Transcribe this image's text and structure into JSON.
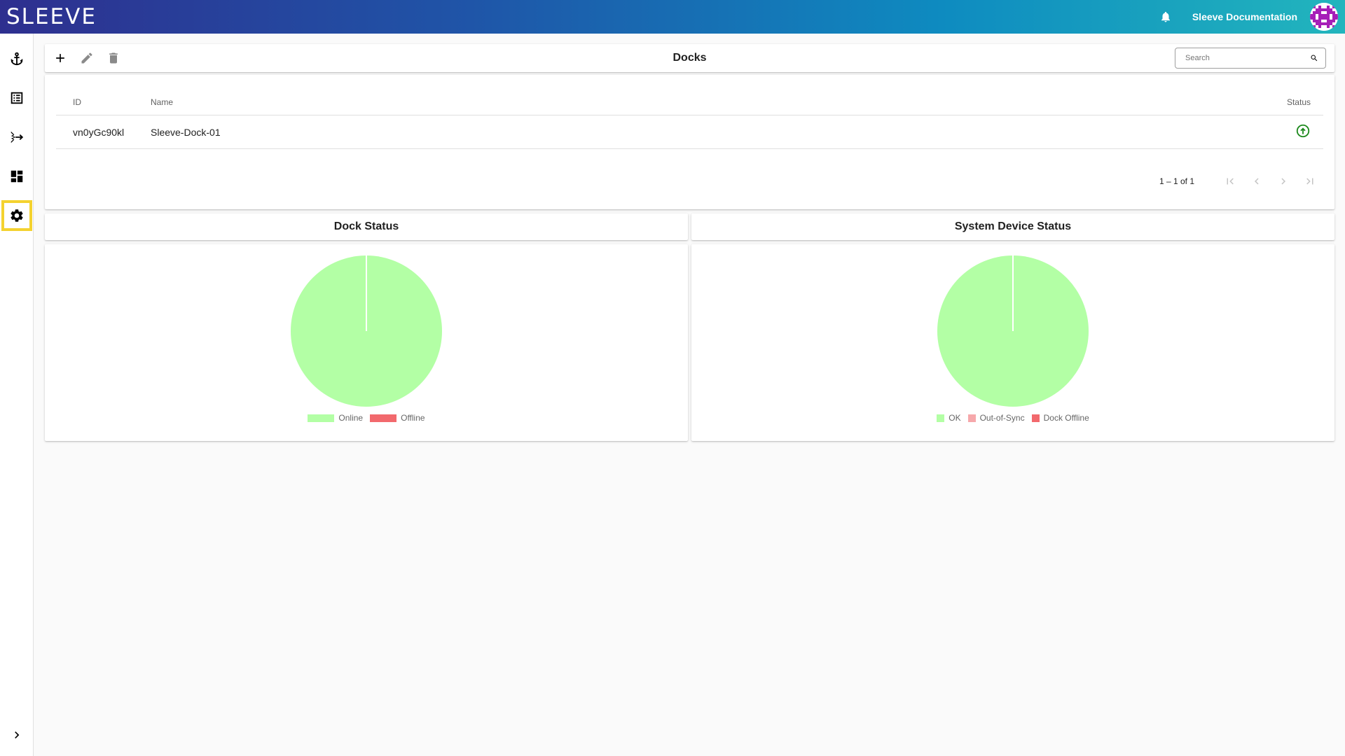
{
  "app": {
    "logo": "SLEEVE",
    "doc_link": "Sleeve Documentation"
  },
  "sidebar": {
    "items": [
      {
        "icon": "anchor-icon"
      },
      {
        "icon": "view-list-icon"
      },
      {
        "icon": "call-split-icon"
      },
      {
        "icon": "dashboard-icon"
      },
      {
        "icon": "gear-icon",
        "active": true
      }
    ],
    "expand_icon": "chevron-right-icon"
  },
  "toolbar": {
    "title": "Docks",
    "search_placeholder": "Search"
  },
  "table": {
    "headers": {
      "id": "ID",
      "name": "Name",
      "status": "Status"
    },
    "rows": [
      {
        "id": "vn0yGc90kl",
        "name": "Sleeve-Dock-01",
        "status": "online"
      }
    ],
    "pager_range": "1 – 1 of 1"
  },
  "dock_status": {
    "title": "Dock Status",
    "legend": [
      "Online",
      "Offline"
    ]
  },
  "system_status": {
    "title": "System Device Status",
    "legend": [
      "OK",
      "Out-of-Sync",
      "Dock Offline"
    ]
  },
  "colors": {
    "ok": "#b3ffa5",
    "offline": "#f2696d",
    "out_of_sync": "#f6a8ab",
    "status_green": "#1e8a1e",
    "highlight": "#f4d22f"
  },
  "chart_data": [
    {
      "type": "pie",
      "title": "Dock Status",
      "categories": [
        "Online",
        "Offline"
      ],
      "values": [
        1,
        0
      ]
    },
    {
      "type": "pie",
      "title": "System Device Status",
      "categories": [
        "OK",
        "Out-of-Sync",
        "Dock Offline"
      ],
      "values": [
        1,
        0,
        0
      ]
    }
  ]
}
